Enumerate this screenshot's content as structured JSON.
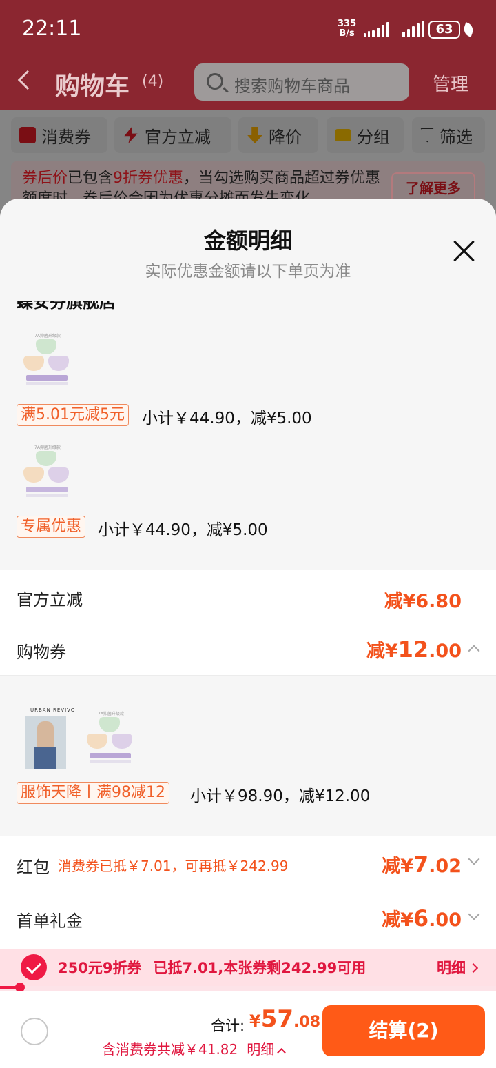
{
  "status_bar": {
    "time": "22:11",
    "net_speed_value": "335",
    "net_speed_unit": "B/s",
    "battery": "63"
  },
  "cart_header": {
    "title": "购物车",
    "count": "(4)",
    "search_placeholder": "搜索购物车商品",
    "manage": "管理"
  },
  "filters": [
    "消费券",
    "官方立减",
    "降价",
    "分组",
    "筛选"
  ],
  "notice": {
    "prefix": "券后价",
    "text_1": "已包含",
    "highlight": "9折券优惠",
    "text_2": "，当勾选购买商品超过券优惠额度时，券后价会因为优惠分摊而发生变化",
    "learn_more": "了解更多"
  },
  "sheet": {
    "title": "金额明细",
    "subtitle": "实际优惠金额请以下单页为准",
    "store_name": "蝶安芬旗舰店",
    "items": [
      {
        "tag": "满5.01元减5元",
        "subtotal": "小计￥44.90，减¥5.00"
      },
      {
        "tag": "专属优惠",
        "subtotal": "小计￥44.90，减¥5.00"
      }
    ],
    "official_discount": {
      "label": "官方立减",
      "amount": "减¥6.80"
    },
    "shopping_coupon": {
      "label": "购物券",
      "amount_prefix": "减¥",
      "amount_int": "12",
      "amount_dec": ".00"
    },
    "coupon_item": {
      "brand": "URBAN REVIVO",
      "tag": "服饰天降丨满98减12",
      "subtotal": "小计￥98.90，减¥12.00"
    },
    "red_packet": {
      "label": "红包",
      "note": "消费券已抵￥7.01，可再抵￥242.99",
      "amount_prefix": "减¥",
      "amount_int": "7",
      "amount_dec": ".02"
    },
    "first_order": {
      "label": "首单礼金",
      "amount_prefix": "减¥",
      "amount_int": "6",
      "amount_dec": ".00"
    },
    "product_caption": "7A抑菌升级款"
  },
  "coupon_bar": {
    "name": "250元9折券",
    "status": "已抵7.01,本张券剩242.99可用",
    "detail": "明细",
    "progress": 0.04
  },
  "bottom_bar": {
    "total_label": "合计:",
    "total_currency": "¥",
    "total_int": "57",
    "total_dec": ".08",
    "saving": "含消费券共减￥41.82",
    "saving_detail": "明细",
    "checkout": "结算(2)"
  },
  "colors": {
    "accent": "#f3521c",
    "coupon_red": "#e0173f",
    "checkout_orange": "#ff5a17"
  }
}
